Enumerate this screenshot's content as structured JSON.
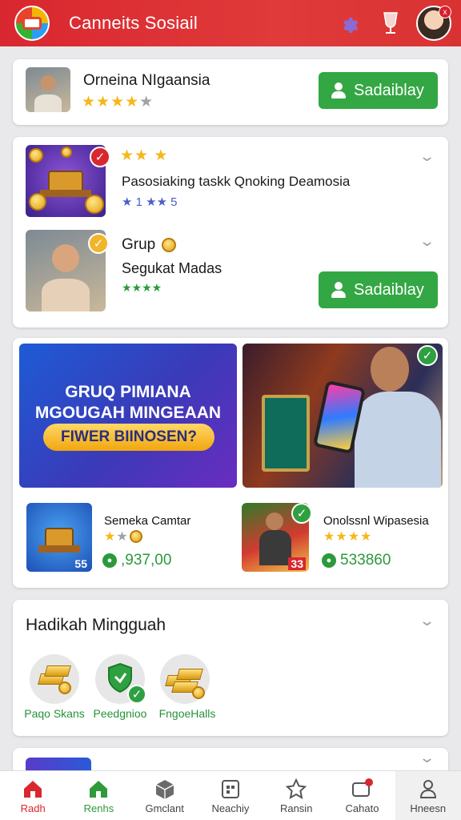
{
  "header": {
    "title": "Canneits Sosiail",
    "icons": [
      "app-logo",
      "gear-icon",
      "goblet-icon",
      "profile-avatar"
    ],
    "avatar_badge": "x"
  },
  "featured": {
    "name": "Orneina NIgaansia",
    "rating": 4,
    "button_label": "Sadaiblay"
  },
  "tasks": {
    "item1": {
      "title": "Pasosiaking taskk Qnoking Deamosia",
      "sub_rating_text": "★ 1 ★★ 5",
      "stars_top": "★★ ★"
    },
    "item2": {
      "title": "Grup",
      "subtitle": "Segukat Madas",
      "rating_text": "★★★★",
      "button_label": "Sadaiblay"
    }
  },
  "promo": {
    "banner_title": "GRUQ PIMIANA MGOUGAH MINGEAAN",
    "banner_cta": "FIWER BIINOSEN?",
    "games": [
      {
        "name": "Semeka Camtar",
        "rating": 2,
        "price": ",937,00",
        "thumb_badge": "55"
      },
      {
        "name": "Onolssnl Wipasesia",
        "rating": 4,
        "price": "533860",
        "thumb_badge": "33"
      }
    ]
  },
  "weekly": {
    "title": "Hadikah Mingguah",
    "rewards": [
      {
        "label": "Paqo Skans",
        "icon": "gold-bars-icon"
      },
      {
        "label": "Peedgnioo",
        "icon": "shield-icon"
      },
      {
        "label": "FngoeHalls",
        "icon": "gold-bars-icon"
      }
    ]
  },
  "nav": {
    "items": [
      {
        "label": "Radh",
        "icon": "home-icon",
        "color": "#d9272f"
      },
      {
        "label": "Renhs",
        "icon": "home-icon",
        "color": "#2f9a3a"
      },
      {
        "label": "Gmclant",
        "icon": "cube-icon",
        "color": "#444444"
      },
      {
        "label": "Neachiy",
        "icon": "calendar-icon",
        "color": "#444444"
      },
      {
        "label": "Ransin",
        "icon": "star-icon",
        "color": "#444444"
      },
      {
        "label": "Cahato",
        "icon": "chat-icon",
        "color": "#444444"
      },
      {
        "label": "Hneesn",
        "icon": "person-icon",
        "color": "#444444"
      }
    ]
  },
  "colors": {
    "header_red": "#d9272f",
    "primary_green": "#33a743",
    "star_gold": "#f5b81a"
  }
}
